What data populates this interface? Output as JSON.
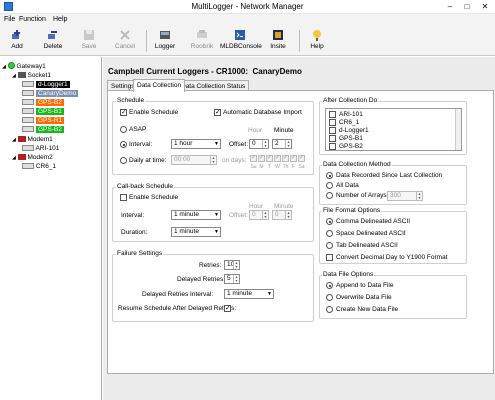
{
  "window": {
    "title": "MultiLogger - Network Manager"
  },
  "menu": [
    "File",
    "Function",
    "Help"
  ],
  "toolbar": [
    {
      "label": "Add",
      "icon": "add-icon",
      "enabled": true
    },
    {
      "label": "Delete",
      "icon": "delete-icon",
      "enabled": true
    },
    {
      "label": "Save",
      "icon": "save-icon",
      "enabled": false
    },
    {
      "label": "Cancel",
      "icon": "cancel-icon",
      "enabled": false
    },
    {
      "label": "Logger",
      "icon": "logger-icon",
      "enabled": true
    },
    {
      "label": "Roobrik",
      "icon": "roobrik-icon",
      "enabled": false
    },
    {
      "label": "MLDBConsole",
      "icon": "console-icon",
      "enabled": true
    },
    {
      "label": "Insite",
      "icon": "insite-icon",
      "enabled": true
    },
    {
      "label": "Help",
      "icon": "help-icon",
      "enabled": true
    }
  ],
  "tree": {
    "gateway": "Gateway1",
    "socket": "Socket1",
    "loggers": [
      {
        "name": "d-Logger1",
        "bg": "#000000",
        "fg": "#ffffff"
      },
      {
        "name": "CanaryDemo",
        "bg": "#7a8fb0",
        "fg": "#ffffff"
      },
      {
        "name": "GPS-B2",
        "bg": "#ff6a00",
        "fg": "#ffffff"
      },
      {
        "name": "GPS-B1",
        "bg": "#16b81c",
        "fg": "#ffffff"
      },
      {
        "name": "GPS-R1",
        "bg": "#ff6a00",
        "fg": "#ffffff"
      },
      {
        "name": "GPS-B2",
        "bg": "#16b81c",
        "fg": "#ffffff"
      }
    ],
    "modem1": "Modem1",
    "modem1_child": "ARI-101",
    "modem2": "Modem2",
    "modem2_child": "CR6_1"
  },
  "header": {
    "title": "Campbell Current Loggers - CR1000:",
    "logger": "CanaryDemo"
  },
  "tabs": [
    "Settings",
    "Data Collection",
    "Data Collection Status"
  ],
  "schedule": {
    "title": "Schedule",
    "enable_label": "Enable Schedule",
    "enable_checked": true,
    "auto_import_label": "Automatic Database Import",
    "auto_import_checked": true,
    "asap_label": "ASAP",
    "interval_label": "Interval:",
    "interval_value": "1 hour",
    "offset_label": "Offset:",
    "hour_label": "Hour",
    "minute_label": "Minute",
    "offset_hour": "0",
    "offset_minute": "2",
    "daily_label": "Daily at time:",
    "daily_value": "00:00",
    "on_days_label": "on days:",
    "days": [
      "Su",
      "M",
      "T",
      "W",
      "Th",
      "F",
      "Sa"
    ],
    "selected": "interval"
  },
  "callback": {
    "title": "Call-back Schedule",
    "enable_label": "Enable Schedule",
    "enable_checked": false,
    "interval_label": "Interval:",
    "interval_value": "1 minute",
    "offset_label": "Offset:",
    "hour_label": "Hour",
    "minute_label": "Minute",
    "offset_hour": "0",
    "offset_minute": "0",
    "duration_label": "Duration:",
    "duration_value": "1 minute"
  },
  "failure": {
    "title": "Failure Settings",
    "retries_label": "Retries:",
    "retries_value": "10",
    "delayed_label": "Delayed Retries:",
    "delayed_value": "5",
    "delayed_interval_label": "Delayed Retries Interval:",
    "delayed_interval_value": "1 minute",
    "resume_label": "Resume Schedule After Delayed Retries:",
    "resume_checked": true
  },
  "after_collection": {
    "title": "After Collection Do",
    "items": [
      "ARI-101",
      "CR6_1",
      "d-Logger1",
      "GPS-B1",
      "GPS-B2"
    ]
  },
  "method": {
    "title": "Data Collection Method",
    "options": [
      "Data Recorded Since Last Collection",
      "All Data",
      "Number of Arrays:"
    ],
    "selected": 0,
    "arrays_value": "300"
  },
  "file_format": {
    "title": "File Format Options",
    "options": [
      "Comma Delineated ASCII",
      "Space Delineated ASCII",
      "Tab Delineated ASCII"
    ],
    "selected": 0,
    "convert_label": "Convert Decimal Day to Y1900 Format",
    "convert_checked": false
  },
  "data_file": {
    "title": "Data File Options",
    "options": [
      "Append to Data File",
      "Overwrite Data File",
      "Create New Data File"
    ],
    "selected": 0
  }
}
